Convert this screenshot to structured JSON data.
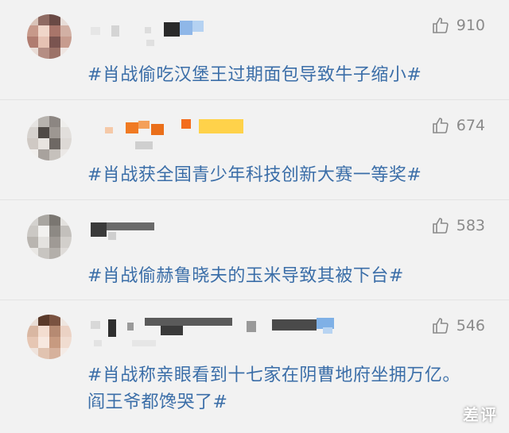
{
  "comments": [
    {
      "likes": "910",
      "text": "#肖战偷吃汉堡王过期面包导致牛子缩小#"
    },
    {
      "likes": "674",
      "text": "#肖战获全国青少年科技创新大赛一等奖#"
    },
    {
      "likes": "583",
      "text": "#肖战偷赫鲁晓夫的玉米导致其被下台#"
    },
    {
      "likes": "546",
      "text": "#肖战称亲眼看到十七家在阴曹地府坐拥万亿。阎王爷都馋哭了#"
    }
  ],
  "watermark": "差评",
  "colors": {
    "hashtag": "#3b6ea8",
    "like_gray": "#8a8a8a",
    "background": "#f2f2f2"
  },
  "icons": {
    "like": "thumbs-up-icon"
  }
}
